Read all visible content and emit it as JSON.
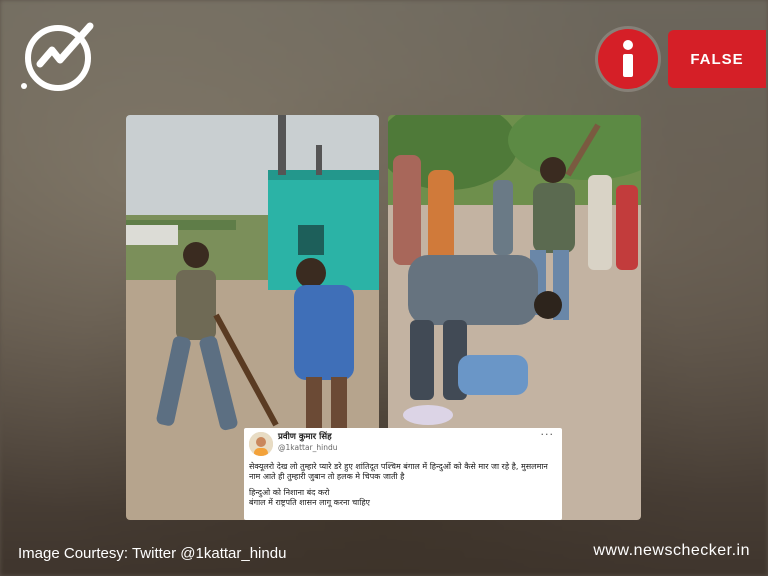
{
  "brand": {
    "logo_icon": "newschecker-check-icon",
    "website": "www.newschecker.in"
  },
  "verdict": {
    "icon": "info-icon",
    "label": "FALSE",
    "color": "#d51f27"
  },
  "images": {
    "left": "street-fight-photo",
    "right": "street-assault-photo"
  },
  "tweet": {
    "author_name": "प्रवीण कुमार सिंह",
    "handle": "@1kattar_hindu",
    "more_icon": "ellipsis-icon",
    "paragraph_1": "सेक्यूलरो देख लो तुम्हारे प्यारे डरे हुए शांतिदूत पश्चिम बंगाल में हिन्दुओं को कैसे मार जा रहे है, मुसलमान नाम आते ही तुम्हारी जुबान तो हलक मे चिपक जाती है",
    "line_2": "हिन्दुओ को निशाना बंद करो",
    "line_3": "बंगाल में राष्ट्रपति शासन लागू करना चाहिए"
  },
  "caption": "Image Courtesy: Twitter @1kattar_hindu"
}
